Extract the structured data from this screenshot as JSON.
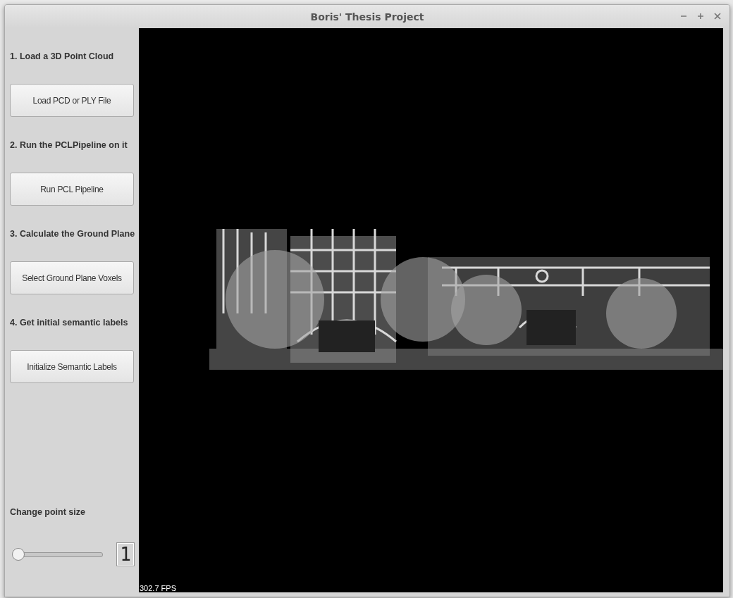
{
  "window": {
    "title": "Boris' Thesis Project"
  },
  "steps": [
    {
      "heading": "1. Load a 3D Point Cloud",
      "button": "Load PCD or PLY File"
    },
    {
      "heading": "2. Run the PCLPipeline on it",
      "button": "Run PCL Pipeline"
    },
    {
      "heading": "3. Calculate the Ground Plane",
      "button": "Select Ground Plane Voxels"
    },
    {
      "heading": "4. Get initial semantic labels",
      "button": "Initialize Semantic Labels"
    }
  ],
  "point_size": {
    "label": "Change point size",
    "level": 0,
    "display": "1"
  },
  "viewer": {
    "fps": "302.7 FPS"
  }
}
